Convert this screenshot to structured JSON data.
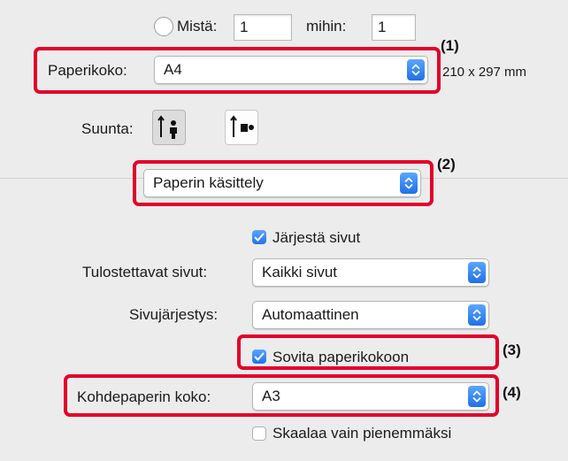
{
  "range": {
    "from_label": "Mistä:",
    "from_value": "1",
    "to_label": "mihin:",
    "to_value": "1"
  },
  "paper_size": {
    "label": "Paperikoko:",
    "value": "A4",
    "dimensions": "210 x 297 mm",
    "callout": "(1)"
  },
  "orientation": {
    "label": "Suunta:",
    "options": [
      "portrait-orientation-icon",
      "landscape-orientation-icon"
    ],
    "selected": 0
  },
  "section": {
    "value": "Paperin käsittely",
    "callout": "(2)"
  },
  "collate": {
    "label": "Järjestä sivut",
    "checked": true
  },
  "pages_to_print": {
    "label": "Tulostettavat sivut:",
    "value": "Kaikki sivut"
  },
  "page_order": {
    "label": "Sivujärjestys:",
    "value": "Automaattinen"
  },
  "scale_to_fit": {
    "label": "Sovita paperikokoon",
    "checked": true,
    "callout": "(3)"
  },
  "dest_paper_size": {
    "label": "Kohdepaperin koko:",
    "value": "A3",
    "callout": "(4)"
  },
  "scale_down_only": {
    "label": "Skaalaa vain pienemmäksi",
    "checked": false
  },
  "colors": {
    "accent": "#2272ea",
    "highlight": "#e3002a",
    "background": "#ececec"
  }
}
